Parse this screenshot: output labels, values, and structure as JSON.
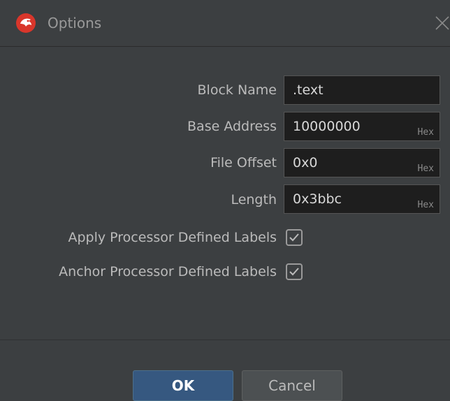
{
  "window": {
    "title": "Options",
    "icon": "ghidra-dragon-icon"
  },
  "form": {
    "block_name": {
      "label": "Block Name",
      "value": ".text"
    },
    "base_address": {
      "label": "Base Address",
      "value": "10000000",
      "suffix": "Hex"
    },
    "file_offset": {
      "label": "File Offset",
      "value": "0x0",
      "suffix": "Hex"
    },
    "length": {
      "label": "Length",
      "value": "0x3bbc",
      "suffix": "Hex"
    },
    "apply_labels": {
      "label": "Apply Processor Defined Labels",
      "checked": true
    },
    "anchor_labels": {
      "label": "Anchor Processor Defined Labels",
      "checked": true
    }
  },
  "buttons": {
    "ok": "OK",
    "cancel": "Cancel"
  },
  "colors": {
    "background": "#3c3f41",
    "field_bg": "#1e1e1e",
    "ok_bg": "#365880",
    "cancel_bg": "#4c5052",
    "icon_red": "#d9362b"
  }
}
